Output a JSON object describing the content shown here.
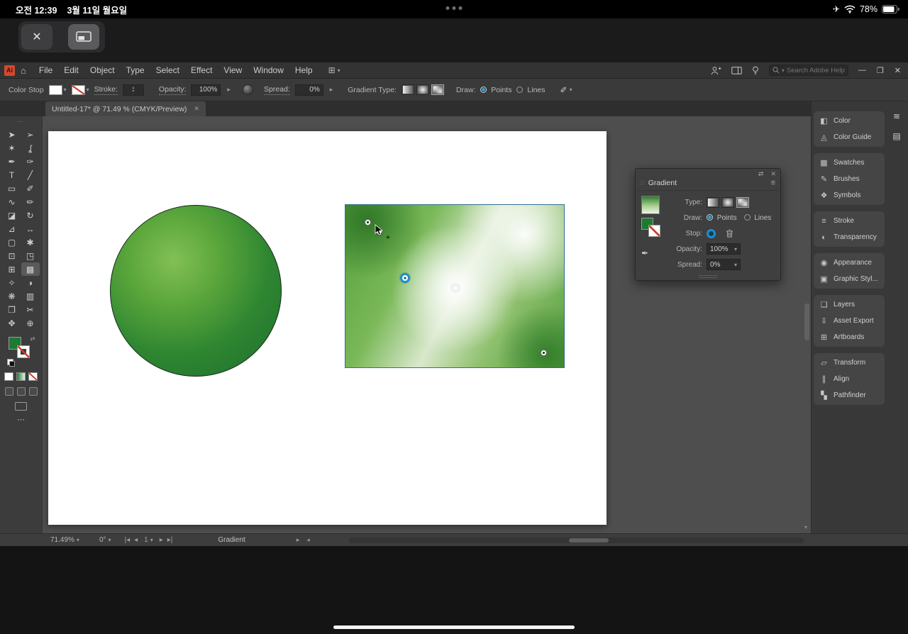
{
  "ios": {
    "time": "오전 12:39",
    "date": "3월 11일 월요일",
    "battery": "78%"
  },
  "icons": {
    "airplane": "✈",
    "home": "⌂",
    "grid": "⊞",
    "chevron_down": "▾",
    "chevron_up": "▴",
    "chevron_right": "▸",
    "chevron_left": "◂",
    "minimize": "—",
    "restore": "❐",
    "close": "✕",
    "brush": "✐",
    "panel_menu": "≡",
    "panel_dots": "∷",
    "eyedropper": "✒",
    "swap": "⇄",
    "ellipsis": "⋯",
    "sliders": "≋",
    "library": "▤"
  },
  "menu": {
    "logo": "Ai",
    "items": [
      "File",
      "Edit",
      "Object",
      "Type",
      "Select",
      "Effect",
      "View",
      "Window",
      "Help"
    ],
    "search_placeholder": "Search Adobe Help"
  },
  "control": {
    "color_stop_label": "Color Stop",
    "stroke_label": "Stroke:",
    "opacity_label": "Opacity:",
    "opacity_value": "100%",
    "spread_label": "Spread:",
    "spread_value": "0%",
    "gradient_type_label": "Gradient Type:",
    "draw_label": "Draw:",
    "points_label": "Points",
    "lines_label": "Lines"
  },
  "tab": {
    "title": "Untitled-17* @ 71.49 % (CMYK/Preview)"
  },
  "tools": [
    {
      "name": "selection-tool",
      "glyph": "➤"
    },
    {
      "name": "direct-selection-tool",
      "glyph": "➢"
    },
    {
      "name": "magic-wand-tool",
      "glyph": "✶"
    },
    {
      "name": "lasso-tool",
      "glyph": "ʆ"
    },
    {
      "name": "pen-tool",
      "glyph": "✒"
    },
    {
      "name": "curvature-tool",
      "glyph": "✑"
    },
    {
      "name": "type-tool",
      "glyph": "T"
    },
    {
      "name": "line-segment-tool",
      "glyph": "╱"
    },
    {
      "name": "rectangle-tool",
      "glyph": "▭"
    },
    {
      "name": "paintbrush-tool",
      "glyph": "✐"
    },
    {
      "name": "shaper-tool",
      "glyph": "∿"
    },
    {
      "name": "pencil-tool",
      "glyph": "✏"
    },
    {
      "name": "eraser-tool",
      "glyph": "◪"
    },
    {
      "name": "rotate-tool",
      "glyph": "↻"
    },
    {
      "name": "scale-tool",
      "glyph": "⊿"
    },
    {
      "name": "width-tool",
      "glyph": "↔"
    },
    {
      "name": "free-transform-tool",
      "glyph": "▢"
    },
    {
      "name": "puppet-warp-tool",
      "glyph": "✱"
    },
    {
      "name": "shape-builder-tool",
      "glyph": "⊡"
    },
    {
      "name": "perspective-grid-tool",
      "glyph": "◳"
    },
    {
      "name": "mesh-tool",
      "glyph": "⊞"
    },
    {
      "name": "gradient-tool",
      "glyph": "▩",
      "selected": true
    },
    {
      "name": "eyedropper-tool",
      "glyph": "✧"
    },
    {
      "name": "blend-tool",
      "glyph": "◑"
    },
    {
      "name": "symbol-sprayer-tool",
      "glyph": "❋"
    },
    {
      "name": "column-graph-tool",
      "glyph": "▥"
    },
    {
      "name": "artboard-tool",
      "glyph": "❒"
    },
    {
      "name": "slice-tool",
      "glyph": "✂"
    },
    {
      "name": "hand-tool",
      "glyph": "✥"
    },
    {
      "name": "zoom-tool",
      "glyph": "⊕"
    }
  ],
  "gradient_panel": {
    "title": "Gradient",
    "type_label": "Type:",
    "draw_label": "Draw:",
    "points_label": "Points",
    "lines_label": "Lines",
    "stop_label": "Stop:",
    "opacity_label": "Opacity:",
    "opacity_value": "100%",
    "spread_label": "Spread:",
    "spread_value": "0%"
  },
  "dock": {
    "groups": [
      {
        "items": [
          {
            "name": "panel-color",
            "label": "Color",
            "glyph": "◧"
          },
          {
            "name": "panel-color-guide",
            "label": "Color Guide",
            "glyph": "◬"
          }
        ]
      },
      {
        "items": [
          {
            "name": "panel-swatches",
            "label": "Swatches",
            "glyph": "▦"
          },
          {
            "name": "panel-brushes",
            "label": "Brushes",
            "glyph": "✎"
          },
          {
            "name": "panel-symbols",
            "label": "Symbols",
            "glyph": "❖"
          }
        ]
      },
      {
        "items": [
          {
            "name": "panel-stroke",
            "label": "Stroke",
            "glyph": "≡"
          },
          {
            "name": "panel-transparency",
            "label": "Transparency",
            "glyph": "◐"
          }
        ]
      },
      {
        "items": [
          {
            "name": "panel-appearance",
            "label": "Appearance",
            "glyph": "◉"
          },
          {
            "name": "panel-graphic-styles",
            "label": "Graphic Styl...",
            "glyph": "▣"
          }
        ]
      },
      {
        "items": [
          {
            "name": "panel-layers",
            "label": "Layers",
            "glyph": "❏"
          },
          {
            "name": "panel-asset-export",
            "label": "Asset Export",
            "glyph": "⇩"
          },
          {
            "name": "panel-artboards",
            "label": "Artboards",
            "glyph": "⊞"
          }
        ]
      },
      {
        "items": [
          {
            "name": "panel-transform",
            "label": "Transform",
            "glyph": "▱"
          },
          {
            "name": "panel-align",
            "label": "Align",
            "glyph": "∥"
          },
          {
            "name": "panel-pathfinder",
            "label": "Pathfinder",
            "glyph": "▚"
          }
        ]
      }
    ]
  },
  "footer": {
    "zoom": "71.49%",
    "rotation": "0°",
    "nav_first": "|◂",
    "nav_prev": "◂",
    "artboard_number": "1",
    "nav_next": "▸",
    "nav_last": "▸|",
    "status": "Gradient"
  },
  "colors": {
    "accent_blue": "#1d8fd0",
    "fill_green": "#1d7a33",
    "sphere_light": "#7cbb4e",
    "sphere_dark": "#1c6f2c",
    "slash_red": "#d03a2b"
  }
}
